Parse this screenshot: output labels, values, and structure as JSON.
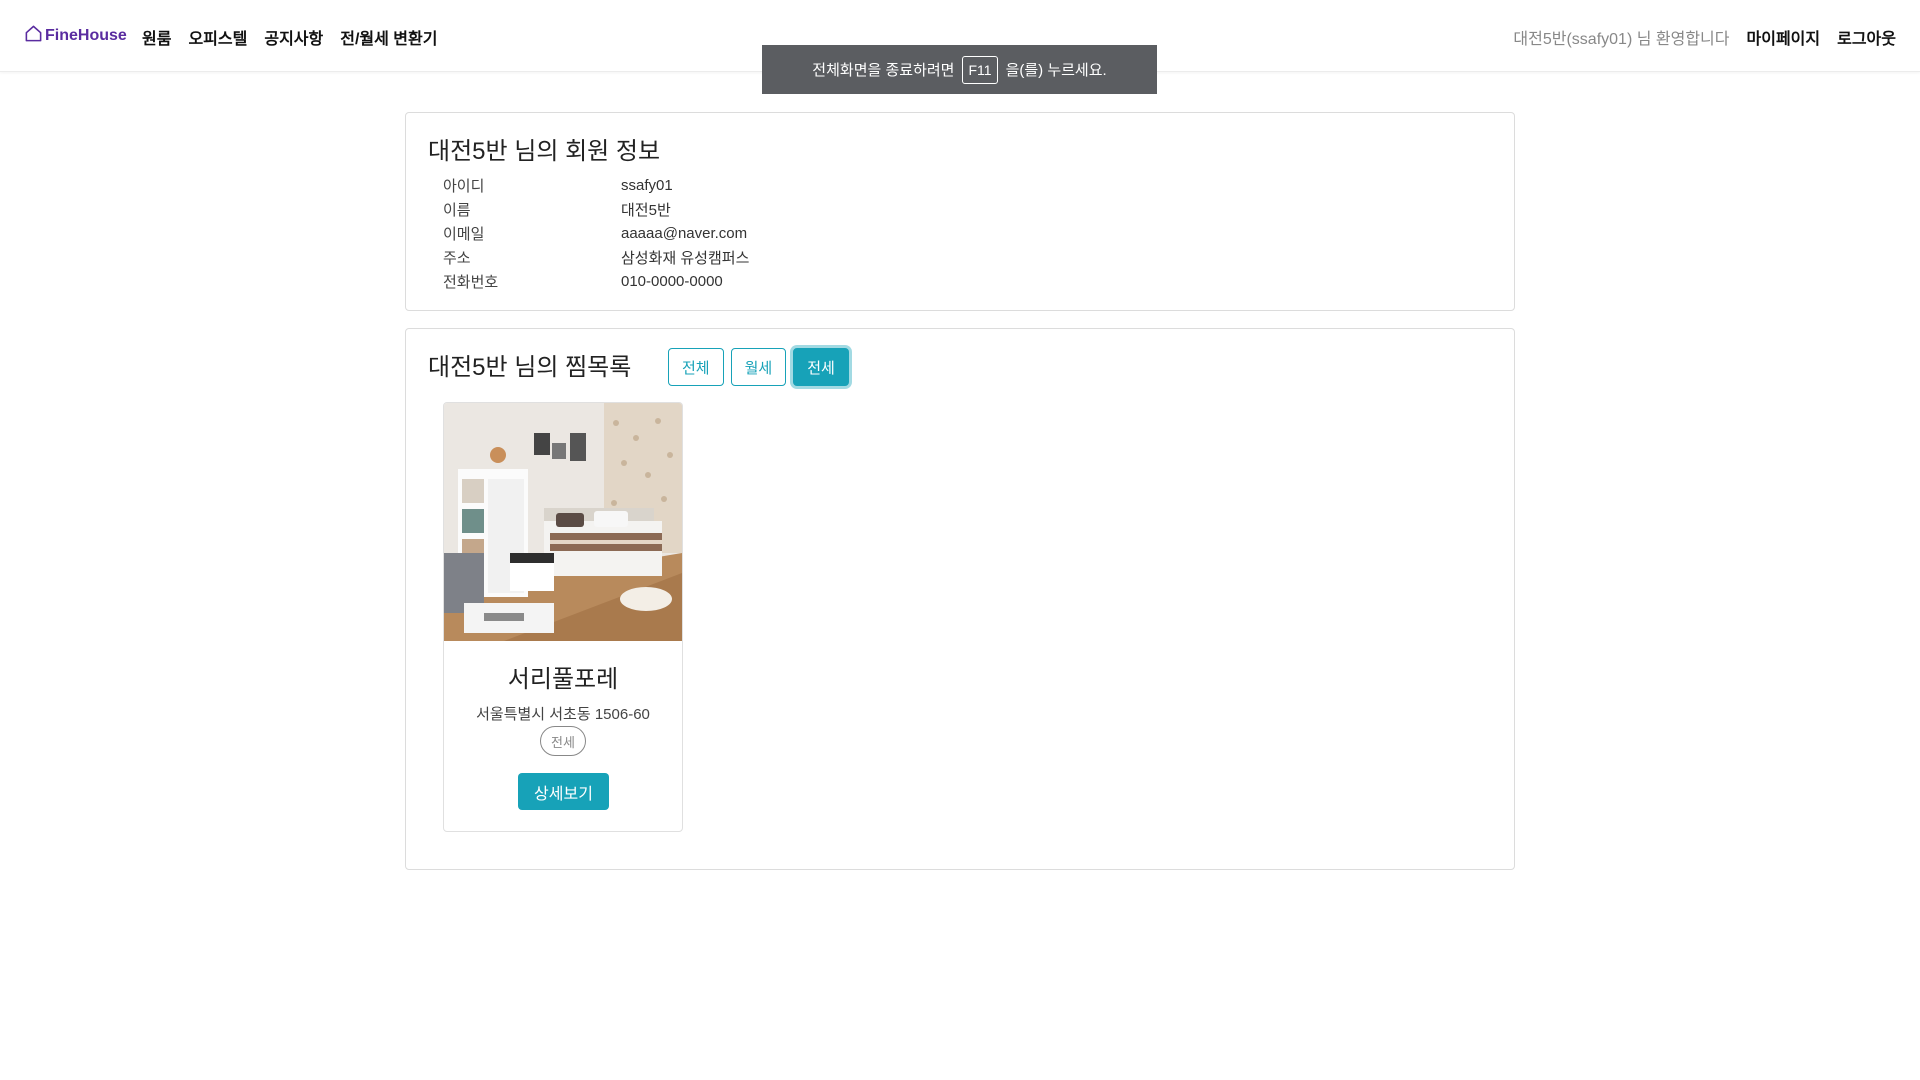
{
  "progress": {
    "fraction": 0.2,
    "color": "#2a7fd4"
  },
  "navbar": {
    "brand": "FineHouse",
    "brand_icon": "house-icon",
    "brand_color": "#5a2ca0",
    "items": [
      {
        "label": "원룸"
      },
      {
        "label": "오피스텔"
      },
      {
        "label": "공지사항"
      },
      {
        "label": "전/월세 변환기"
      }
    ],
    "welcome": "대전5반(ssafy01) 님 환영합니다",
    "mypage": "마이페이지",
    "logout": "로그아웃"
  },
  "fullscreen_toast": {
    "prefix": "전체화면을 종료하려면",
    "key": "F11",
    "suffix": "을(를) 누르세요."
  },
  "member_info": {
    "title": "대전5반 님의 회원 정보",
    "rows": [
      {
        "label": "아이디",
        "value": "ssafy01"
      },
      {
        "label": "이름",
        "value": "대전5반"
      },
      {
        "label": "이메일",
        "value": "aaaaa@naver.com"
      },
      {
        "label": "주소",
        "value": "삼성화재 유성캠퍼스"
      },
      {
        "label": "전화번호",
        "value": "010-0000-0000"
      }
    ]
  },
  "wishlist": {
    "title": "대전5반 님의 찜목록",
    "filters": [
      {
        "label": "전체",
        "active": false
      },
      {
        "label": "월세",
        "active": false
      },
      {
        "label": "전세",
        "active": true
      }
    ],
    "accent": "#17a2b8",
    "cards": [
      {
        "name": "서리풀포레",
        "address": "서울특별시 서초동 1506-60",
        "deal_type": "전세",
        "button": "상세보기"
      }
    ]
  }
}
